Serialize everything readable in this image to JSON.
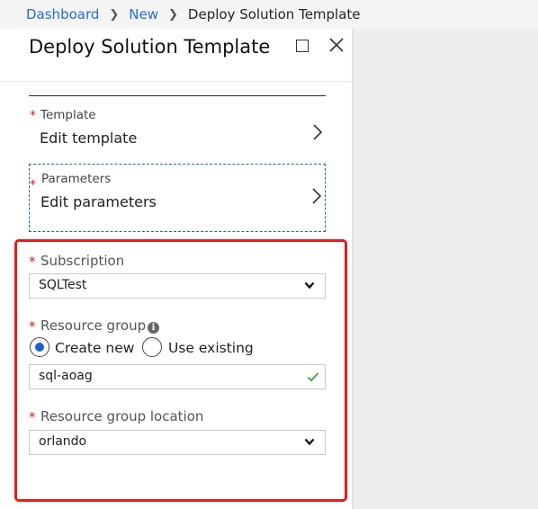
{
  "breadcrumb": {
    "items": [
      "Dashboard",
      "New"
    ],
    "current": "Deploy Solution Template"
  },
  "blade": {
    "title": "Deploy Solution Template",
    "template": {
      "label": "Template",
      "value": "Edit template"
    },
    "parameters": {
      "label": "Parameters",
      "value": "Edit parameters"
    },
    "subscription": {
      "label": "Subscription",
      "value": "SQLTest"
    },
    "resource_group": {
      "label": "Resource group",
      "options": [
        "Create new",
        "Use existing"
      ],
      "selected": "Create new",
      "value": "sql-aoag"
    },
    "resource_group_location": {
      "label": "Resource group location",
      "value": "orlando"
    }
  },
  "required_marker": "*",
  "info_glyph": "i",
  "colors": {
    "link": "#2a6ad3",
    "required": "#d51e1e",
    "highlight": "#e31d1d",
    "radio_selected": "#1e5fc7",
    "valid": "#3aa335"
  }
}
